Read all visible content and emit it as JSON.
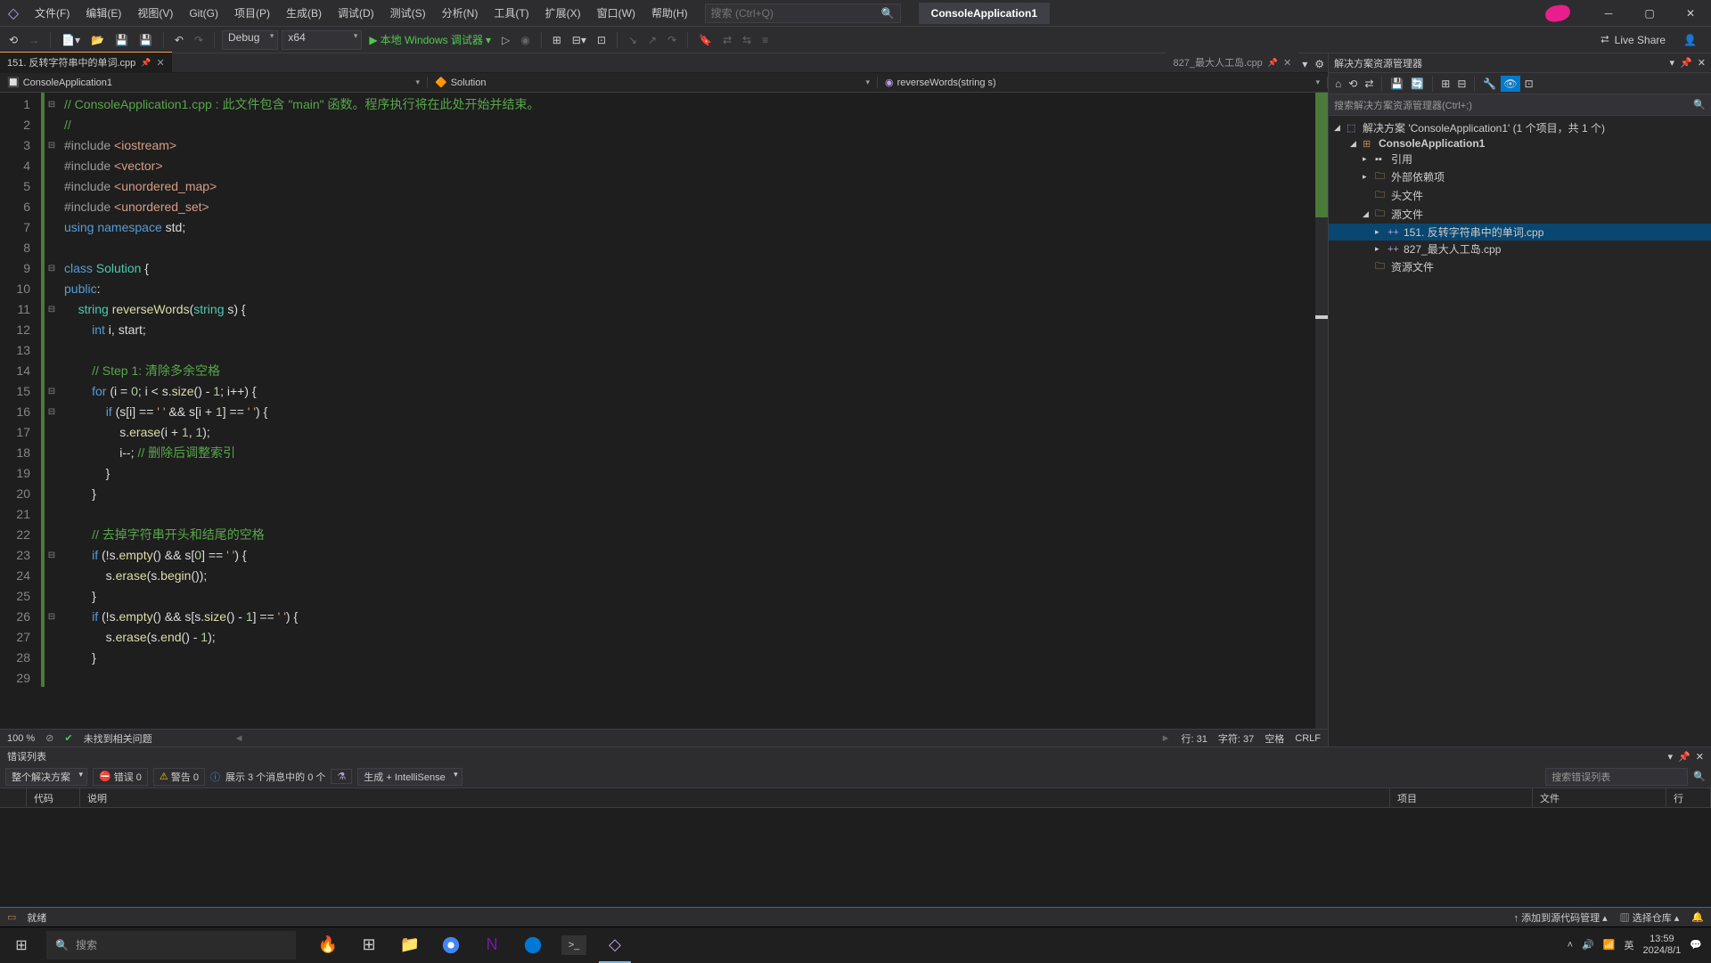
{
  "menu": [
    "文件(F)",
    "编辑(E)",
    "视图(V)",
    "Git(G)",
    "项目(P)",
    "生成(B)",
    "调试(D)",
    "测试(S)",
    "分析(N)",
    "工具(T)",
    "扩展(X)",
    "窗口(W)",
    "帮助(H)"
  ],
  "search_placeholder": "搜索 (Ctrl+Q)",
  "project_title": "ConsoleApplication1",
  "toolbar": {
    "config": "Debug",
    "platform": "x64",
    "start_label": "本地 Windows 调试器",
    "live_share": "Live Share"
  },
  "tabs": [
    {
      "name": "151. 反转字符串中的单词.cpp",
      "active": true,
      "pinned": true
    },
    {
      "name": "827_最大人工岛.cpp",
      "active": false,
      "pinned": true
    }
  ],
  "nav": {
    "scope": "ConsoleApplication1",
    "class": "Solution",
    "member": "reverseWords(string s)"
  },
  "editor_status": {
    "zoom": "100 %",
    "issues": "未找到相关问题",
    "line": "行: 31",
    "col": "字符: 37",
    "ins": "空格",
    "enc": "CRLF"
  },
  "solution_explorer": {
    "title": "解决方案资源管理器",
    "search_placeholder": "搜索解决方案资源管理器(Ctrl+;)",
    "root": "解决方案 'ConsoleApplication1' (1 个项目，共 1 个)",
    "project": "ConsoleApplication1",
    "nodes": {
      "references": "引用",
      "external": "外部依赖项",
      "headers": "头文件",
      "sources": "源文件",
      "src1": "151. 反转字符串中的单词.cpp",
      "src2": "827_最大人工岛.cpp",
      "resources": "资源文件"
    }
  },
  "error_list": {
    "title": "错误列表",
    "scope": "整个解决方案",
    "errors": "错误 0",
    "warnings": "警告 0",
    "messages": "展示 3 个消息中的 0 个",
    "source": "生成 + IntelliSense",
    "search": "搜索错误列表",
    "cols": {
      "code": "代码",
      "desc": "说明",
      "project": "项目",
      "file": "文件",
      "line": "行"
    }
  },
  "statusbar": {
    "ready": "就绪",
    "source_control": "添加到源代码管理",
    "repo": "选择仓库"
  },
  "taskbar": {
    "search": "搜索",
    "time": "13:59",
    "date": "2024/8/1",
    "lang": "英"
  },
  "code_lines": [
    {
      "n": 1,
      "fold": "⊟",
      "html": "<span class='c-comment'>// ConsoleApplication1.cpp : 此文件包含 \"main\" 函数。程序执行将在此处开始并结束。</span>"
    },
    {
      "n": 2,
      "fold": "",
      "html": "<span class='c-comment'>//</span>"
    },
    {
      "n": 3,
      "fold": "⊟",
      "html": "<span class='c-macro'>#include</span> <span class='c-string'>&lt;iostream&gt;</span>"
    },
    {
      "n": 4,
      "fold": "",
      "html": "<span class='c-macro'>#include</span> <span class='c-string'>&lt;vector&gt;</span>"
    },
    {
      "n": 5,
      "fold": "",
      "html": "<span class='c-macro'>#include</span> <span class='c-string'>&lt;unordered_map&gt;</span>"
    },
    {
      "n": 6,
      "fold": "",
      "html": "<span class='c-macro'>#include</span> <span class='c-string'>&lt;unordered_set&gt;</span>"
    },
    {
      "n": 7,
      "fold": "",
      "html": "<span class='c-keyword'>using</span> <span class='c-keyword'>namespace</span> std;"
    },
    {
      "n": 8,
      "fold": "",
      "html": ""
    },
    {
      "n": 9,
      "fold": "⊟",
      "html": "<span class='c-keyword'>class</span> <span class='c-type'>Solution</span> {"
    },
    {
      "n": 10,
      "fold": "",
      "html": "<span class='c-keyword'>public</span>:"
    },
    {
      "n": 11,
      "fold": "⊟",
      "html": "    <span class='c-type'>string</span> <span class='c-func'>reverseWords</span>(<span class='c-type'>string</span> s) {"
    },
    {
      "n": 12,
      "fold": "",
      "html": "        <span class='c-keyword'>int</span> i, start;"
    },
    {
      "n": 13,
      "fold": "",
      "html": ""
    },
    {
      "n": 14,
      "fold": "",
      "html": "        <span class='c-comment'>// Step 1: 清除多余空格</span>"
    },
    {
      "n": 15,
      "fold": "⊟",
      "html": "        <span class='c-keyword'>for</span> (i = <span class='c-num'>0</span>; i &lt; s.<span class='c-func'>size</span>() - <span class='c-num'>1</span>; i++) {"
    },
    {
      "n": 16,
      "fold": "⊟",
      "html": "            <span class='c-keyword'>if</span> (s[i] == <span class='c-string'>' '</span> &amp;&amp; s[i + <span class='c-num'>1</span>] == <span class='c-string'>' '</span>) {"
    },
    {
      "n": 17,
      "fold": "",
      "html": "                s.<span class='c-func'>erase</span>(i + <span class='c-num'>1</span>, <span class='c-num'>1</span>);"
    },
    {
      "n": 18,
      "fold": "",
      "html": "                i--; <span class='c-comment'>// 删除后调整索引</span>"
    },
    {
      "n": 19,
      "fold": "",
      "html": "            }"
    },
    {
      "n": 20,
      "fold": "",
      "html": "        }"
    },
    {
      "n": 21,
      "fold": "",
      "html": ""
    },
    {
      "n": 22,
      "fold": "",
      "html": "        <span class='c-comment'>// 去掉字符串开头和结尾的空格</span>"
    },
    {
      "n": 23,
      "fold": "⊟",
      "html": "        <span class='c-keyword'>if</span> (!s.<span class='c-func'>empty</span>() &amp;&amp; s[<span class='c-num'>0</span>] == <span class='c-string'>' '</span>) {"
    },
    {
      "n": 24,
      "fold": "",
      "html": "            s.<span class='c-func'>erase</span>(s.<span class='c-func'>begin</span>());"
    },
    {
      "n": 25,
      "fold": "",
      "html": "        }"
    },
    {
      "n": 26,
      "fold": "⊟",
      "html": "        <span class='c-keyword'>if</span> (!s.<span class='c-func'>empty</span>() &amp;&amp; s[s.<span class='c-func'>size</span>() - <span class='c-num'>1</span>] == <span class='c-string'>' '</span>) {"
    },
    {
      "n": 27,
      "fold": "",
      "html": "            s.<span class='c-func'>erase</span>(s.<span class='c-func'>end</span>() - <span class='c-num'>1</span>);"
    },
    {
      "n": 28,
      "fold": "",
      "html": "        }"
    },
    {
      "n": 29,
      "fold": "",
      "html": ""
    }
  ]
}
